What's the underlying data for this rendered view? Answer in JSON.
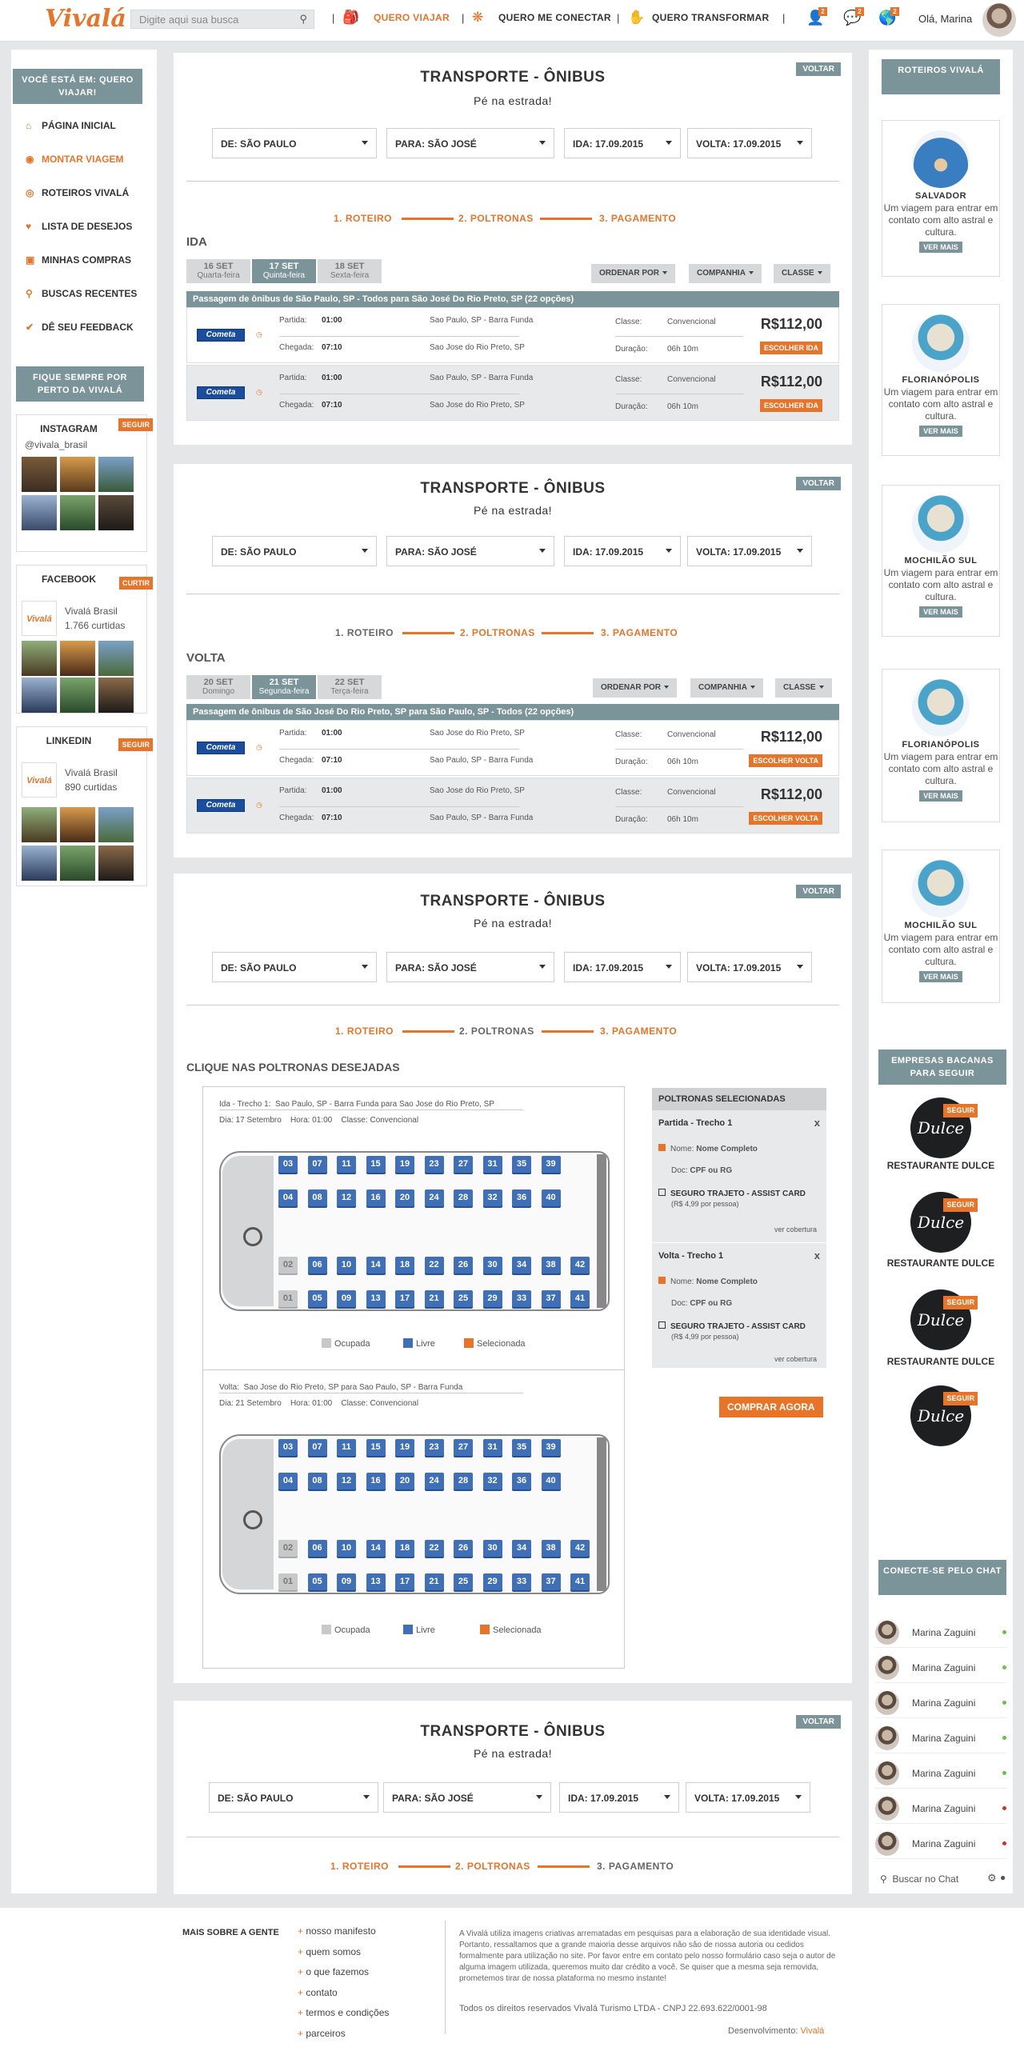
{
  "brand": {
    "logo": "Vivalá",
    "accent": "#e8742a",
    "gray": "#7b949a"
  },
  "header": {
    "search_placeholder": "Digite aqui sua busca",
    "nav": [
      "QUERO VIAJAR",
      "QUERO ME CONECTAR",
      "QUERO TRANSFORMAR"
    ],
    "badges": [
      "2",
      "2",
      "2"
    ],
    "greeting": "Olá, Marina"
  },
  "sidebar": {
    "location_title": "VOCÊ ESTÁ EM: QUERO VIAJAR!",
    "menu": [
      "PÁGINA INICIAL",
      "MONTAR VIAGEM",
      "ROTEIROS VIVALÁ",
      "LISTA DE DESEJOS",
      "MINHAS COMPRAS",
      "BUSCAS RECENTES",
      "DÊ SEU FEEDBACK"
    ],
    "follow_title": "FIQUE SEMPRE POR PERTO DA VIVALÁ",
    "instagram": {
      "title": "INSTAGRAM",
      "button": "SEGUIR",
      "handle": "@vivala_brasil"
    },
    "facebook": {
      "title": "FACEBOOK",
      "button": "CURTIR",
      "name": "Vivalá Brasil",
      "count": "1.766 curtidas"
    },
    "linkedin": {
      "title": "LINKEDIN",
      "button": "SEGUIR",
      "name": "Vivalá Brasil",
      "count": "890 curtidas"
    }
  },
  "common": {
    "title": "TRANSPORTE - ÔNIBUS",
    "subtitle": "Pé na estrada!",
    "voltar": "VOLTAR",
    "from": "DE: SÃO PAULO",
    "to": "PARA: SÃO JOSÉ",
    "ida": "IDA: 17.09.2015",
    "volta": "VOLTA: 17.09.2015",
    "steps": [
      "1. ROTEIRO",
      "2. POLTRONAS",
      "3. PAGAMENTO"
    ],
    "sort": "ORDENAR POR",
    "company": "COMPANHIA",
    "class": "CLASSE",
    "partida": "Partida:",
    "chegada": "Chegada:",
    "classe": "Classe:",
    "duracao": "Duração:",
    "t1": "01:00",
    "t2": "07:10",
    "conv": "Convencional",
    "dur": "06h 10m",
    "price": "R$112,00",
    "company_logo": "Cometa"
  },
  "panel1": {
    "label": "IDA",
    "tabs": [
      {
        "d": "16 SET",
        "w": "Quarta-feira"
      },
      {
        "d": "17 SET",
        "w": "Quinta-feira"
      },
      {
        "d": "18 SET",
        "w": "Sexta-feira"
      }
    ],
    "bar": "Passagem de ônibus de São Paulo, SP - Todos para São José Do Rio Preto, SP  (22 opções)",
    "from_st": "Sao Paulo, SP - Barra Funda",
    "to_st": "Sao Jose do Rio Preto, SP",
    "btn": "ESCOLHER IDA"
  },
  "panel2": {
    "label": "VOLTA",
    "tabs": [
      {
        "d": "20 SET",
        "w": "Domingo"
      },
      {
        "d": "21 SET",
        "w": "Segunda-feira"
      },
      {
        "d": "22 SET",
        "w": "Terça-feira"
      }
    ],
    "bar": "Passagem de ônibus de São José Do Rio Preto, SP para São Paulo, SP - Todos  (22 opções)",
    "from_st": "Sao Jose do Rio Preto, SP",
    "to_st": "Sao Paulo, SP - Barra Funda",
    "btn": "ESCOLHER VOLTA"
  },
  "panel3": {
    "heading": "CLIQUE NAS POLTRONAS DESEJADAS",
    "trip1": {
      "line1_label": "Ida - Trecho 1:",
      "line1": "Sao Paulo, SP - Barra Funda para Sao Jose do Rio Preto, SP",
      "dia": "Dia: 17 Setembro",
      "hora": "Hora: 01:00",
      "classe": "Classe: Convencional"
    },
    "trip2": {
      "line1_label": "Volta:",
      "line1": "Sao Jose do Rio Preto, SP para Sao Paulo, SP - Barra Funda",
      "dia": "Dia: 21 Setembro",
      "hora": "Hora: 01:00",
      "classe": "Classe: Convencional"
    },
    "legend": [
      "Ocupada",
      "Livre",
      "Selecionada"
    ],
    "selected_title": "POLTRONAS SELECIONADAS",
    "sel1": "Partida - Trecho 1",
    "sel2": "Volta - Trecho 1",
    "nome_l": "Nome:",
    "nome": "Nome Completo",
    "doc_l": "Doc:",
    "doc": "CPF ou RG",
    "seguro": "SEGURO TRAJETO - ASSIST CARD",
    "seguro_price": "(R$ 4,99 por pessoa)",
    "cobertura": "ver cobertura",
    "close": "x",
    "buy": "COMPRAR AGORA",
    "row1": [
      "03",
      "07",
      "11",
      "15",
      "19",
      "23",
      "27",
      "31",
      "35",
      "39"
    ],
    "row2": [
      "04",
      "08",
      "12",
      "16",
      "20",
      "24",
      "28",
      "32",
      "36",
      "40"
    ],
    "row3": [
      "02",
      "06",
      "10",
      "14",
      "18",
      "22",
      "26",
      "30",
      "34",
      "38",
      "42"
    ],
    "row4": [
      "01",
      "05",
      "09",
      "13",
      "17",
      "21",
      "25",
      "29",
      "33",
      "37",
      "41"
    ]
  },
  "right": {
    "roteiros_title": "ROTEIROS VIVALÁ",
    "roteiros": [
      {
        "name": "SALVADOR",
        "desc": "Um viagem para entrar em contato com alto astral e cultura."
      },
      {
        "name": "FLORIANÓPOLIS",
        "desc": "Um viagem para entrar em contato com alto astral e cultura."
      },
      {
        "name": "MOCHILÃO SUL",
        "desc": "Um viagem para entrar em contato com alto astral e cultura."
      },
      {
        "name": "FLORIANÓPOLIS",
        "desc": "Um viagem para entrar em contato com alto astral e cultura."
      },
      {
        "name": "MOCHILÃO SUL",
        "desc": "Um viagem para entrar em contato com alto astral e cultura."
      }
    ],
    "ver_mais": "VER MAIS",
    "empresas_title": "EMPRESAS BACANAS PARA SEGUIR",
    "empresa": "RESTAURANTE DULCE",
    "empresa_logo": "Dulce",
    "seguir": "SEGUIR",
    "chat_title": "CONECTE-SE PELO CHAT",
    "chat_name": "Marina Zaguini",
    "chat_search": "Buscar no Chat"
  },
  "footer": {
    "title": "MAIS SOBRE A GENTE",
    "links": [
      "nosso manifesto",
      "quem somos",
      "o que fazemos",
      "contato",
      "termos e condições",
      "parceiros"
    ],
    "text": "A Vivalá utiliza imagens criativas arrematadas em pesquisas para a elaboração de sua identidade visual. Portanto, ressaltamos que a grande maioria desse arquivos não são de nossa autoria ou cedidos formalmente para utilização no site. Por favor entre em contato pelo nosso formulário caso seja o autor de alguma imagem utilizada, queremos muito dar crédito a você. Se quiser que a mesma seja removida, prometemos tirar de nossa plataforma no mesmo instante!",
    "copy": "Todos os direitos reservados Vivalá Turismo LTDA   -  CNPJ 22.693.622/0001-98",
    "dev_label": "Desenvolvimento:",
    "dev": "Vivalá"
  }
}
